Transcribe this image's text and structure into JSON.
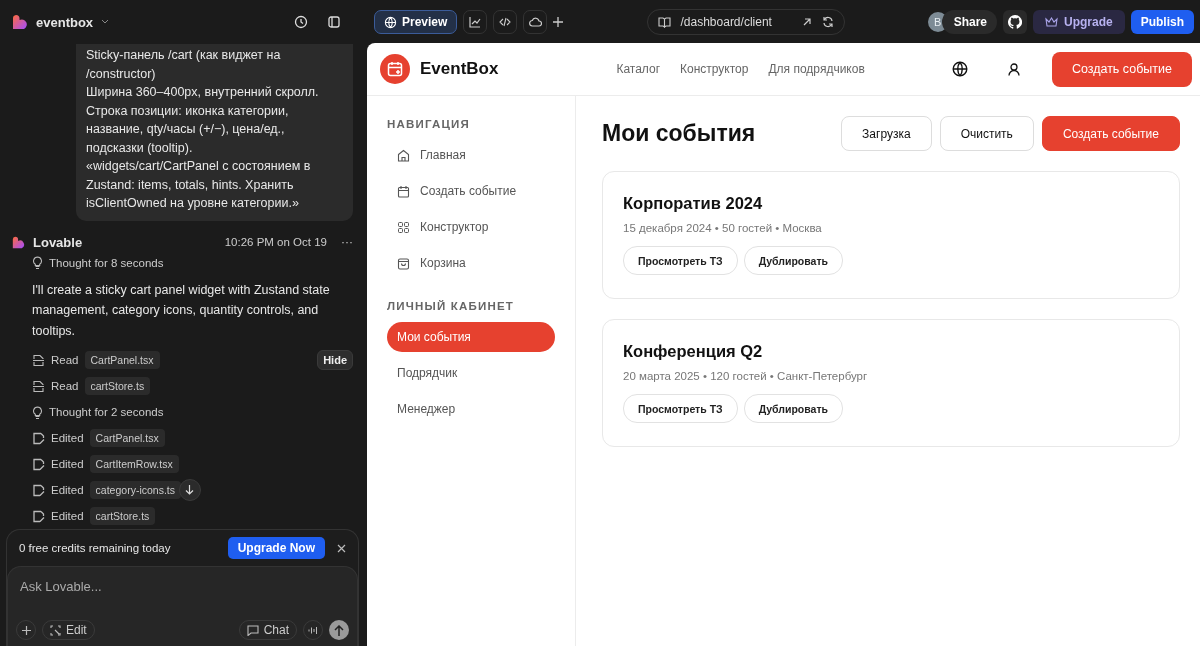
{
  "app": {
    "name": "eventbox"
  },
  "toolbar": {
    "preview": "Preview",
    "url": "/dashboard/client",
    "avatar": "B",
    "share": "Share",
    "upgrade": "Upgrade",
    "publish": "Publish"
  },
  "chat": {
    "user_message": "Sticky-панель /cart (как виджет на\n/constructor)\nШирина 360–400px, внутренний скролл.\nСтрока позиции: иконка категории,\nназвание, qty/часы (+/−), цена/ед.,\nподсказки (tooltip).\n«widgets/cart/CartPanel с состоянием в\nZustand: items, totals, hints. Хранить\nisClientOwned на уровне категории.»",
    "author": "Lovable",
    "time": "10:26 PM on Oct 19",
    "more": "···",
    "thought": "Thought for 8 seconds",
    "reply": "I'll create a sticky cart panel widget with Zustand state management, category icons, quantity controls, and tooltips.",
    "hide": "Hide",
    "steps": [
      {
        "kind": "read",
        "label": "Read",
        "file": "CartPanel.tsx"
      },
      {
        "kind": "read",
        "label": "Read",
        "file": "cartStore.ts"
      },
      {
        "kind": "thought",
        "label": "Thought for 2 seconds"
      },
      {
        "kind": "edited",
        "label": "Edited",
        "file": "CartPanel.tsx"
      },
      {
        "kind": "edited",
        "label": "Edited",
        "file": "CartItemRow.tsx"
      },
      {
        "kind": "edited",
        "label": "Edited",
        "file": "category-icons.ts"
      },
      {
        "kind": "edited",
        "label": "Edited",
        "file": "cartStore.ts"
      }
    ]
  },
  "credits": {
    "text": "0 free credits remaining today",
    "button": "Upgrade Now"
  },
  "composer": {
    "placeholder": "Ask Lovable...",
    "edit": "Edit",
    "chat": "Chat"
  },
  "site": {
    "brand": "EventBox",
    "nav": [
      "Каталог",
      "Конструктор",
      "Для подрядчиков"
    ],
    "cta": "Создать событие",
    "sidebar": [
      {
        "title": "НАВИГАЦИЯ",
        "items": [
          {
            "label": "Главная",
            "selected": false
          },
          {
            "label": "Создать событие",
            "selected": false
          },
          {
            "label": "Конструктор",
            "selected": false
          },
          {
            "label": "Корзина",
            "selected": false
          }
        ]
      },
      {
        "title": "ЛИЧНЫЙ КАБИНЕТ",
        "items": [
          {
            "label": "Мои события",
            "selected": true
          },
          {
            "label": "Подрядчик",
            "selected": false
          },
          {
            "label": "Менеджер",
            "selected": false
          }
        ]
      }
    ],
    "title": "Мои события",
    "actions": [
      {
        "label": "Загрузка",
        "kind": "outline"
      },
      {
        "label": "Очистить",
        "kind": "outline"
      },
      {
        "label": "Создать событие",
        "kind": "primary"
      }
    ],
    "events": [
      {
        "title": "Корпоратив 2024",
        "meta": "15 декабря 2024 • 50 гостей • Москва",
        "buttons": [
          "Просмотреть ТЗ",
          "Дублировать"
        ]
      },
      {
        "title": "Конференция Q2",
        "meta": "20 марта 2025 • 120 гостей • Санкт-Петербург",
        "buttons": [
          "Просмотреть ТЗ",
          "Дублировать"
        ]
      }
    ]
  }
}
